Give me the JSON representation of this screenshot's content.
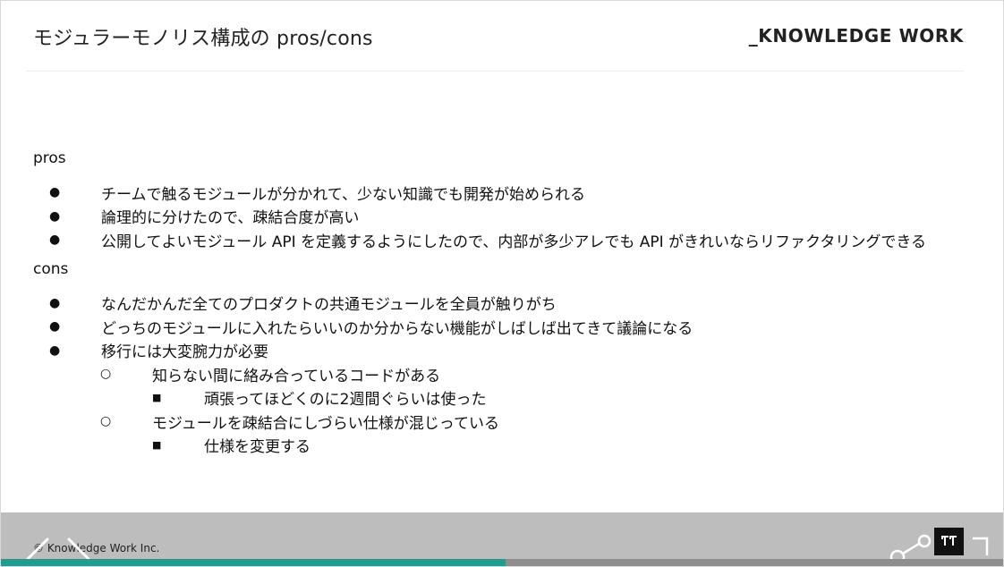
{
  "slide": {
    "title": "モジュラーモノリス構成の pros/cons",
    "brand": "_KNOWLEDGE WORK",
    "pros_label": "pros",
    "pros_items": [
      "チームで触るモジュールが分かれて、少ない知識でも開発が始められる",
      "論理的に分けたので、疎結合度が高い",
      "公開してよいモジュール API を定義するようにしたので、内部が多少アレでも API がきれいならリファクタリングできる"
    ],
    "cons_label": "cons",
    "cons_items": [
      "なんだかんだ全てのプロダクトの共通モジュールを全員が触りがち",
      "どっちのモジュールに入れたらいいのか分からない機能がしばしば出てきて議論になる",
      "移行には大変腕力が必要"
    ],
    "cons_sub": [
      "知らない間に絡み合っているコードがある",
      "モジュールを疎結合にしづらい仕様が混じっている"
    ],
    "cons_subsub": [
      "頑張ってほどくのに2週間ぐらいは使った",
      "仕様を変更する"
    ],
    "bullets": {
      "level1": "●",
      "level2": "○",
      "level3": "■"
    }
  },
  "footer": {
    "copyright": "© Knowledge Work Inc.",
    "progress": 0.504,
    "colors": {
      "progress": "#1e9e8f",
      "track": "#8e8e8e",
      "bar": "#bdbdbd"
    }
  },
  "controls": {
    "prev_icon": "chevron-left-icon",
    "next_icon": "chevron-right-icon",
    "share_icon": "share-icon",
    "fullscreen_icon": "fullscreen-icon"
  }
}
